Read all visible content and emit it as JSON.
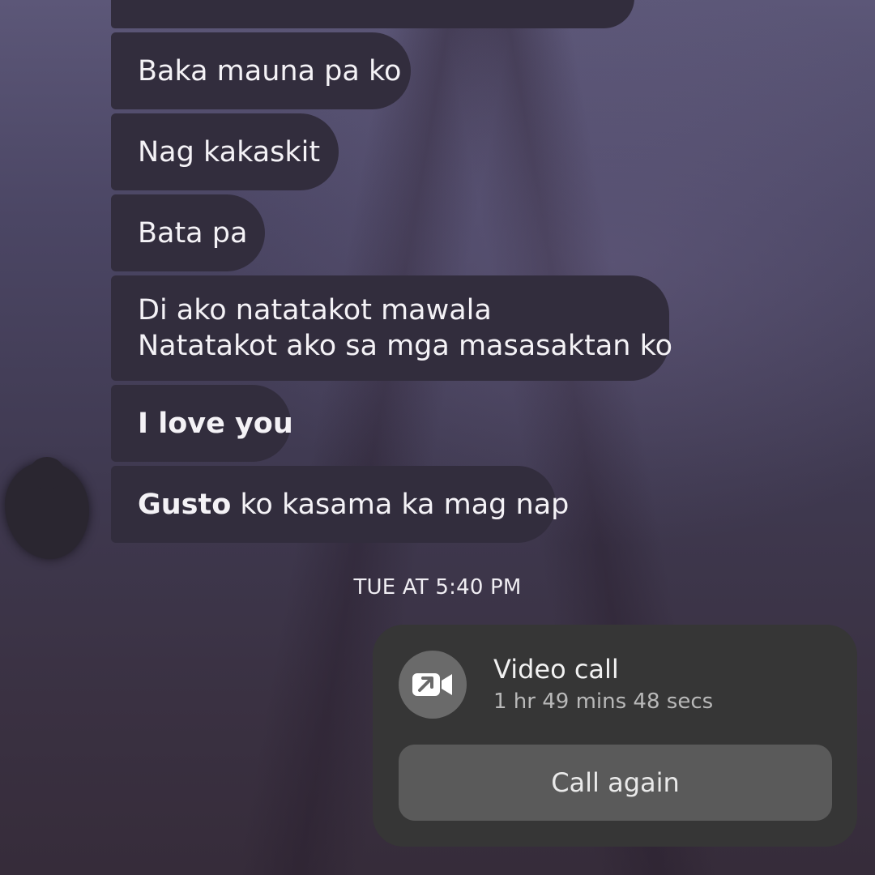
{
  "messages": [
    {
      "text": "Baka mauna pa ko"
    },
    {
      "text": "Nag kakaskit"
    },
    {
      "text": "Bata pa"
    },
    {
      "line1": "Di ako natatakot mawala",
      "line2": "Natatakot ako sa mga masasaktan ko"
    },
    {
      "text": "I love you"
    },
    {
      "strong": "Gusto",
      "rest": " ko kasama ka mag nap"
    }
  ],
  "timestamp": "TUE AT 5:40 PM",
  "call": {
    "icon": "video-call-outgoing-icon",
    "title": "Video call",
    "duration": "1 hr 49 mins 48 secs",
    "action_label": "Call again"
  },
  "colors": {
    "bubble": "#322d3d",
    "card": "#363636",
    "button": "#5a5a5a"
  }
}
